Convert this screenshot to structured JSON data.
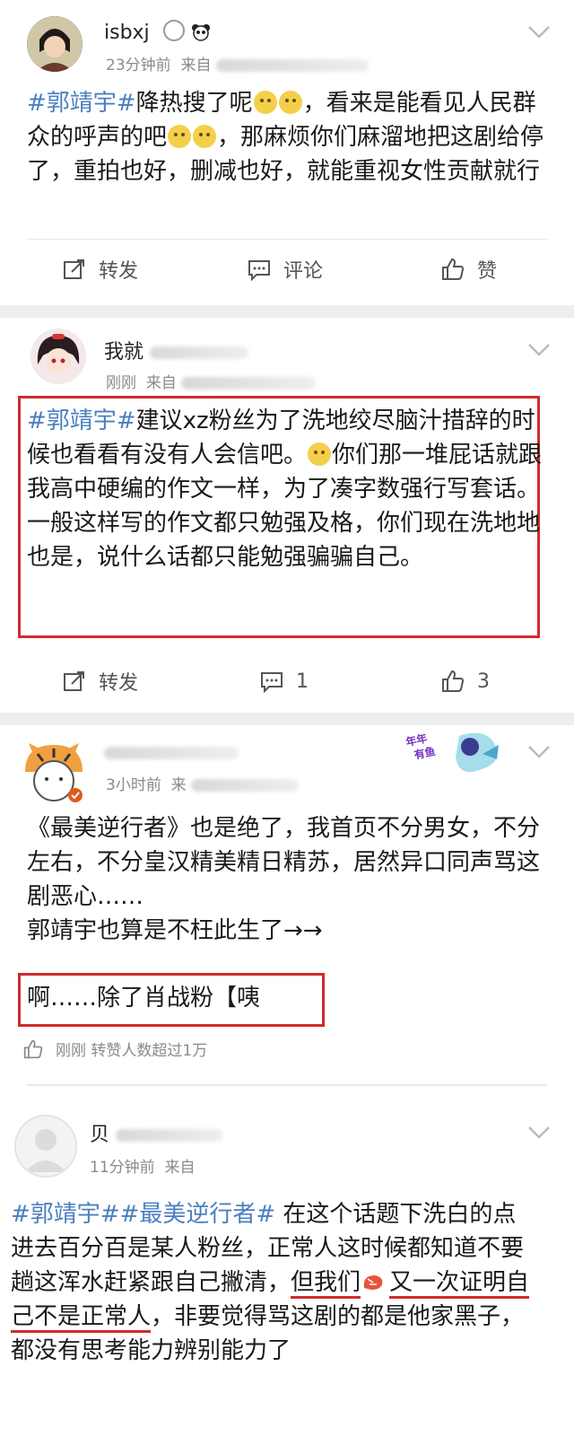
{
  "posts": [
    {
      "username": "isbxj",
      "time": "23分钟前",
      "source": "来自",
      "text_parts": [
        "#郭靖宇#",
        "降热搜了呢",
        "，看来是能看见人民群众的呼声的吧",
        "，那麻烦你们麻溜地把这剧给停了，重拍也好，删减也好，就能重视女性贡献就行"
      ],
      "actions": {
        "repost": "转发",
        "comment": "评论",
        "like": "赞"
      }
    },
    {
      "username": "我就",
      "time": "刚刚",
      "source": "来自",
      "text_parts": [
        "#郭靖宇#",
        "建议xz粉丝为了洗地绞尽脑汁措辞的时候也看看有没有人会信吧。",
        "你们那一堆屁话就跟我高中硬编的作文一样，为了凑字数强行写套话。",
        "一般这样写的作文都只勉强及格，你们现在洗地地也是，说什么话都只能勉强骗骗自己。"
      ],
      "actions": {
        "repost": "转发",
        "comment": "1",
        "like": "3"
      }
    },
    {
      "time": "3小时前",
      "source": "来",
      "badge_text": [
        "年年",
        "有鱼"
      ],
      "lines": [
        "《最美逆行者》也是绝了，我首页不分男女，不分左右，不分皇汉精美精日精苏，居然异口同声骂这剧恶心……",
        "郭靖宇也算是不枉此生了→→"
      ],
      "boxed_line": "啊……除了肖战粉【咦",
      "footer_time": "刚刚",
      "footer_note": "转赞人数超过1万"
    },
    {
      "username": "贝",
      "time": "11分钟前",
      "source": "来自",
      "text_tags": "#郭靖宇##最美逆行者#",
      "text_a": " 在这个话题下洗白的点进去百分百是某人粉丝，正常人这时候都知道不要趟这浑水赶紧跟自己撇清，",
      "text_u1": "但我们",
      "text_u2": "又一次证明自己不是正常人",
      "text_b": "，非要觉得骂这剧的都是他家黑子，都没有思考能力辨别能力了"
    }
  ],
  "colors": {
    "tag": "#4a7fbf",
    "highlight_box": "#d12a2a"
  }
}
